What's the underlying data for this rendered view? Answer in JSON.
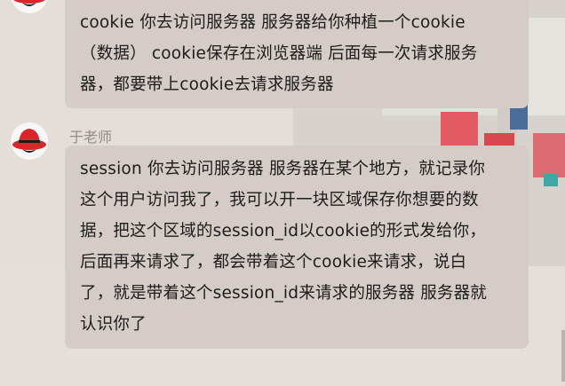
{
  "messages": [
    {
      "sender": "",
      "avatar_icon": "red-hat-avatar-icon",
      "lines": [
        "cookie   你去访问服务器  服务器给你种植一个cookie",
        "（数据）  cookie保存在浏览器端  后面每一次请求服务",
        "器，都要带上cookie去请求服务器"
      ]
    },
    {
      "sender": "于老师",
      "avatar_icon": "red-hat-avatar-icon",
      "lines": [
        "session 你去访问服务器  服务器在某个地方，就记录你",
        "这个用户访问我了，我可以开一块区域保存你想要的数",
        "据，把这个区域的session_id以cookie的形式发给你，",
        "后面再来请求了，都会带着这个cookie来请求，说白",
        "了，就是带着这个session_id来请求的服务器  服务器就",
        "认识你了"
      ]
    }
  ],
  "colors": {
    "bubble": "#d5ccc7",
    "background": "#e4ddd8",
    "avatar_red": "#d8262d"
  }
}
